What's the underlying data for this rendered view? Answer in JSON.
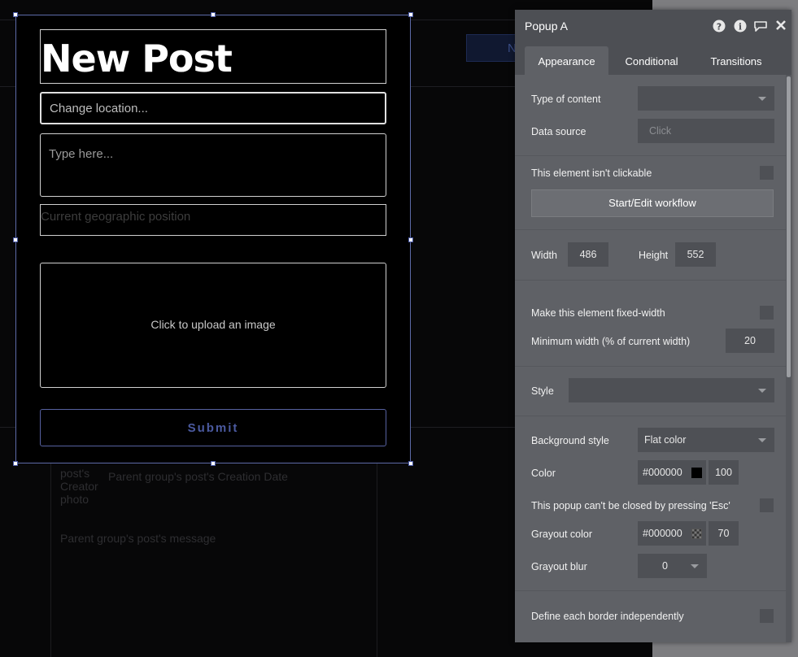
{
  "popup": {
    "title": "New Post",
    "location_placeholder": "Change location...",
    "message_placeholder": "Type here...",
    "geo_placeholder": "Current geographic position",
    "upload_label": "Click to upload an image",
    "submit_label": "Submit"
  },
  "background": {
    "button_text": "N",
    "creator_label_1": "post's",
    "creator_label_2": "Creator",
    "creator_label_3": "photo",
    "date_text": "Parent group's post's Creation Date",
    "message_text": "Parent group's post's message"
  },
  "editor": {
    "title": "Popup A",
    "icons": [
      "help-icon",
      "info-icon",
      "comment-icon",
      "close-icon"
    ],
    "tabs": [
      "Appearance",
      "Conditional",
      "Transitions"
    ],
    "active_tab": "Appearance",
    "type_of_content_label": "Type of content",
    "type_of_content_value": "",
    "data_source_label": "Data source",
    "data_source_placeholder": "Click",
    "not_clickable_label": "This element isn't clickable",
    "workflow_button": "Start/Edit workflow",
    "width_label": "Width",
    "width_value": "486",
    "height_label": "Height",
    "height_value": "552",
    "fixed_width_label": "Make this element fixed-width",
    "min_width_label": "Minimum width (% of current width)",
    "min_width_value": "20",
    "style_label": "Style",
    "style_value": "",
    "bg_style_label": "Background style",
    "bg_style_value": "Flat color",
    "color_label": "Color",
    "color_hex": "#000000",
    "color_opacity": "100",
    "esc_label": "This popup can't be closed by pressing 'Esc'",
    "grayout_color_label": "Grayout color",
    "grayout_hex": "#000000",
    "grayout_opacity": "70",
    "grayout_blur_label": "Grayout blur",
    "grayout_blur_value": "0",
    "border_independent_label": "Define each border independently"
  },
  "colors": {
    "accent": "#4b5aa0",
    "panel_bg": "#5f6166",
    "swatch_color": "#000000"
  }
}
